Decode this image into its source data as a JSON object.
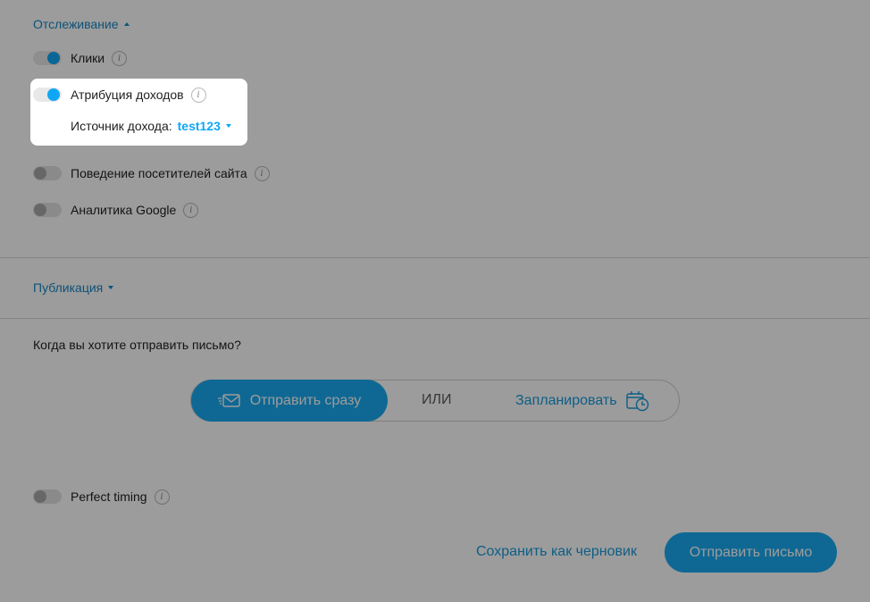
{
  "tracking": {
    "header": "Отслеживание",
    "items": [
      {
        "label": "Клики",
        "enabled": true
      },
      {
        "label": "Атрибуция доходов",
        "enabled": true
      },
      {
        "label": "Поведение посетителей сайта",
        "enabled": false
      },
      {
        "label": "Аналитика Google",
        "enabled": false
      }
    ],
    "revenue_source": {
      "label": "Источник дохода:",
      "value": "test123"
    }
  },
  "publication": {
    "header": "Публикация"
  },
  "sending": {
    "question": "Когда вы хотите отправить письмо?",
    "send_now_label": "Отправить сразу",
    "or_label": "ИЛИ",
    "schedule_label": "Запланировать"
  },
  "perfect_timing": {
    "label": "Perfect timing",
    "enabled": false
  },
  "footer": {
    "save_draft_label": "Сохранить как черновик",
    "send_label": "Отправить письмо"
  },
  "colors": {
    "accent": "#1aaaf0",
    "link": "#1786c4",
    "overlay": "rgba(0,0,0,0.39)"
  },
  "info_icon_glyph": "i"
}
